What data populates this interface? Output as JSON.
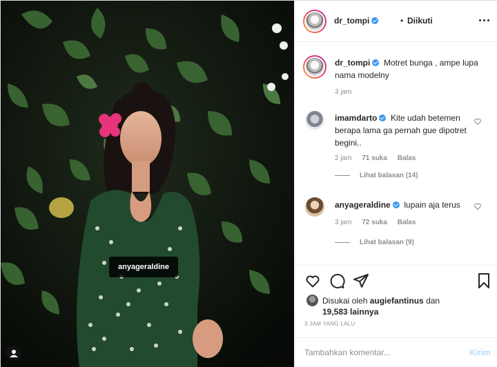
{
  "post": {
    "username": "dr_tompi",
    "follow_status": "Diikuti",
    "separator": "•",
    "caption": "Motret bunga , ampe lupa nama modelny",
    "caption_time": "3 jam",
    "photo_tag": "anyageraldine"
  },
  "comments": [
    {
      "username": "imamdarto",
      "text": "Kite udah betemen berapa lama ga pernah gue dipotret begini..",
      "time": "2 jam",
      "likes": "71 suka",
      "reply": "Balas",
      "view_replies": "Lihat balasan (14)"
    },
    {
      "username": "anyageraldine",
      "text": "lupain aja terus",
      "time": "3 jam",
      "likes": "72 suka",
      "reply": "Balas",
      "view_replies": "Lihat balasan (9)"
    }
  ],
  "likes": {
    "prefix": "Disukai oleh",
    "user": "augiefantinus",
    "conjunction": "dan",
    "others": "19,583 lainnya"
  },
  "timestamp": "3 JAM YANG LALU",
  "add_comment": {
    "placeholder": "Tambahkan komentar...",
    "send_label": "Kirim"
  },
  "colors": {
    "verified": "#3897f0",
    "send_disabled": "#b3dbff",
    "secondary_text": "#8e8e8e",
    "primary_text": "#262626"
  },
  "icons": [
    "more-horizontal-icon",
    "verified-badge-icon",
    "heart-icon",
    "comment-icon",
    "share-icon",
    "bookmark-icon",
    "user-tag-icon"
  ]
}
